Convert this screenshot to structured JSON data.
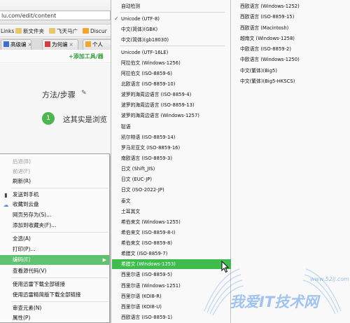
{
  "browser": {
    "url": "lu.com/edit/content",
    "bookmarks": [
      "Links",
      "新文件夹",
      "飞天马广",
      "Discur"
    ],
    "tabs": [
      "高级编",
      "为何编",
      "个人"
    ],
    "toolbar_add": "+添加工具/器",
    "page": {
      "method_title": "方法/步骤",
      "step_number": "1",
      "step_text": "这其实是浏览"
    }
  },
  "context_menu": {
    "items": [
      {
        "label": "后退(B)",
        "disabled": true
      },
      {
        "label": "前进(F)",
        "disabled": true
      },
      {
        "label": "刷新(R)",
        "icon": "refresh-icon"
      },
      {
        "label": "发送到手机",
        "icon": "phone-icon"
      },
      {
        "label": "收藏到云盘",
        "icon": "cloud-icon"
      },
      {
        "label": "网页另存为(S)..."
      },
      {
        "label": "添加到收藏夹(F)..."
      },
      {
        "label": "全选(A)"
      },
      {
        "label": "打印(P)..."
      },
      {
        "label": "编码(E)",
        "submenu": true,
        "active": true
      },
      {
        "label": "查看源代码(V)"
      },
      {
        "label": "使用迅雷下载全部链接"
      },
      {
        "label": "使用迅雷精简版下载全部链接"
      },
      {
        "label": "审查元素(N)"
      },
      {
        "label": "属性(P)"
      }
    ]
  },
  "encoding_menu": {
    "column1": [
      "自动检测",
      "Unicode (UTF-8)",
      "中文(简体)(GBK)",
      "中文(简体)(gb18030)",
      "Unicode (UTF-16LE)",
      "阿拉伯文 (Windows-1256)",
      "阿拉伯文 (ISO-8859-6)",
      "北欧语言 (ISO-8859-10)",
      "波罗的海周边语言 (ISO-8859-4)",
      "波罗的海周边语言 (ISO-8859-13)",
      "波罗的海周边语言 (Windows-1257)",
      "鞑语",
      "凯尔特语 (ISO-8859-14)",
      "罗马尼亚文 (ISO-8859-16)",
      "南欧语言 (ISO-8859-3)",
      "日文 (Shift_JIS)",
      "日文 (EUC-JP)",
      "日文 (ISO-2022-JP)",
      "泰文",
      "土耳其文",
      "希伯来文 (Windows-1255)",
      "希伯来文 (ISO-8859-8-I)",
      "希伯来文 (ISO-8859-8)",
      "希腊文 (ISO-8859-7)",
      "希腊文 (Windows-1253)",
      "西里尔语 (ISO-8859-5)",
      "西里尔语 (Windows-1251)",
      "西里尔语 (KOI8-R)",
      "西里尔语 (KOI8-U)",
      "西欧语言 (ISO-8859-1)"
    ],
    "selected": "Unicode (UTF-8)",
    "highlighted": "希腊文 (Windows-1253)",
    "column2": [
      "西欧语言 (Windows-1252)",
      "西欧语言 (ISO-8859-15)",
      "西欧语言 (Macintosh)",
      "越南文 (Windows-1258)",
      "中欧语言 (ISO-8859-2)",
      "中欧语言 (Windows-1250)",
      "中文(繁体)(Big5)",
      "中文(繁体)(Big5-HKSCS)"
    ]
  },
  "watermark": {
    "text": "我爱IT技术网",
    "url": "www.52ij.com"
  },
  "colors": {
    "highlight": "#3ebd4e",
    "context_active": "#5ec26e",
    "watermark": "#5898e8"
  }
}
